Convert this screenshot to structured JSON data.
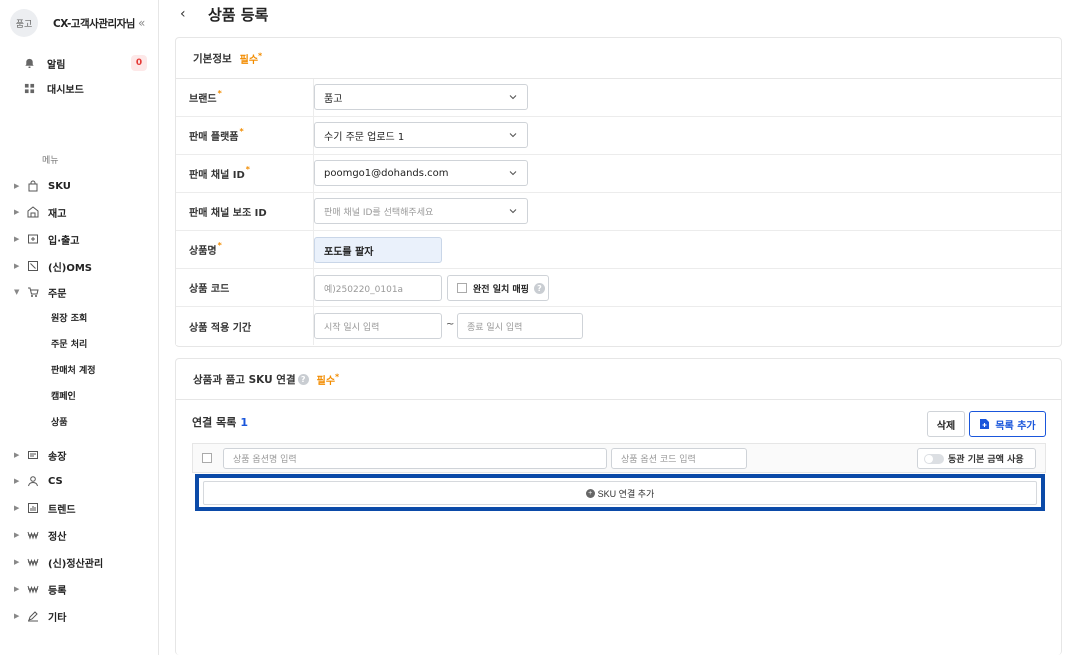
{
  "sidebar": {
    "avatar_text": "품고",
    "brand_name": "CX-고객사관리자님",
    "collapse_icon": "«",
    "alarm_label": "알림",
    "alarm_count": "0",
    "dashboard_label": "대시보드",
    "menu_label": "메뉴",
    "nav": [
      "SKU",
      "재고",
      "입·출고",
      "(신)OMS",
      "주문",
      "송장",
      "CS",
      "트렌드",
      "정산",
      "(신)정산관리",
      "등록",
      "기타"
    ],
    "order_sub": [
      "원장 조회",
      "주문 처리",
      "판매처 계정",
      "캠페인",
      "상품"
    ]
  },
  "header": {
    "back": "‹",
    "title": "상품 등록"
  },
  "basic": {
    "title": "기본정보",
    "required": "필수",
    "star": "*",
    "brand_label": "브랜드",
    "brand_value": "품고",
    "platform_label": "판매 플랫폼",
    "platform_value": "수기 주문 업로드 1",
    "channel_label": "판매 채널 ID",
    "channel_value": "poomgo1@dohands.com",
    "sub_channel_label": "판매 채널 보조 ID",
    "sub_channel_placeholder": "판매 채널 ID를 선택해주세요",
    "name_label": "상품명",
    "name_value": "포도를 팔자",
    "code_label": "상품 코드",
    "code_placeholder": "예)250220_0101a",
    "exact_match_label": "완전 일치 매핑",
    "period_label": "상품 적용 기간",
    "start_placeholder": "시작 일시 입력",
    "dash": "~",
    "end_placeholder": "종료 일시 입력"
  },
  "sku": {
    "title": "상품과 품고 SKU 연결",
    "help": "?",
    "required": "필수",
    "star": "*",
    "list_title": "연결 목록",
    "list_count": "1",
    "delete_label": "삭제",
    "add_list_label": "목록 추가",
    "option_name_placeholder": "상품 옵션명 입력",
    "option_code_placeholder": "상품 옵션 코드 입력",
    "toggle_label": "동관 기본 금액 사용",
    "add_sku_label": "SKU 연결 추가"
  }
}
